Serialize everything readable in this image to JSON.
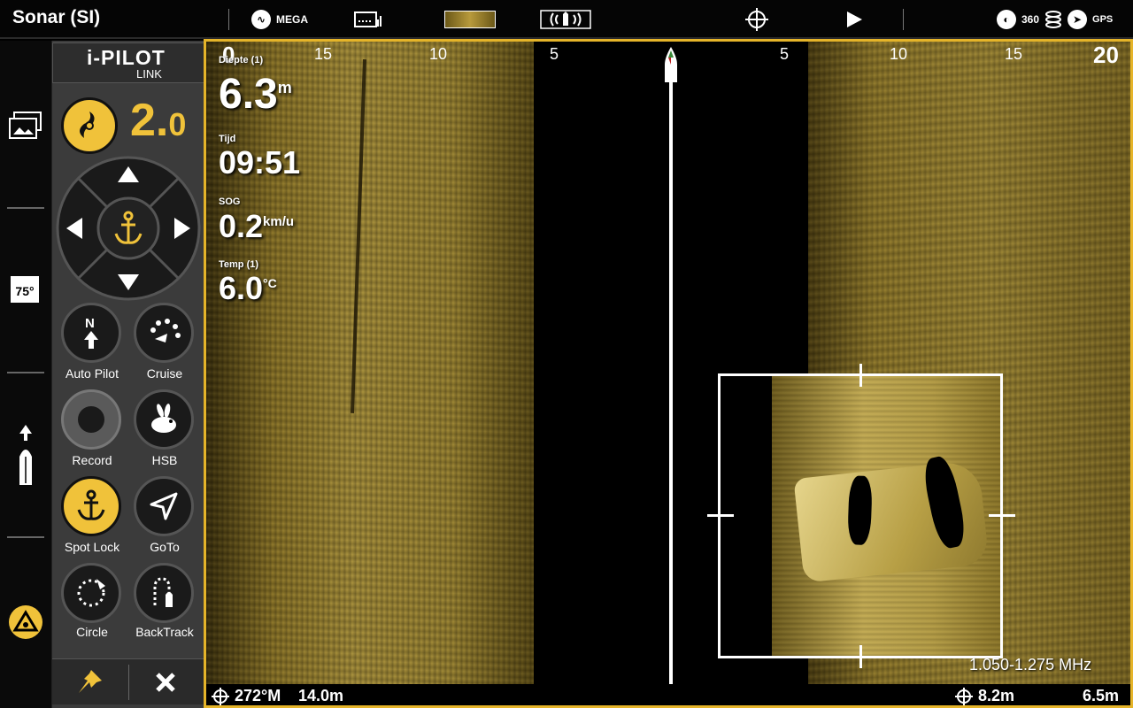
{
  "topbar": {
    "title": "Sonar (SI)",
    "mega_label": "MEGA",
    "right_360": "360",
    "gps_label": "GPS"
  },
  "leftcol": {
    "temp_icon_text": "75°"
  },
  "ipilot": {
    "brand": "i-PILOT",
    "sub": "LINK",
    "speed_main": "2.",
    "speed_decimal": "0",
    "buttons": [
      {
        "label": "Auto Pilot"
      },
      {
        "label": "Cruise"
      },
      {
        "label": "Record"
      },
      {
        "label": "HSB"
      },
      {
        "label": "Spot Lock"
      },
      {
        "label": "GoTo"
      },
      {
        "label": "Circle"
      },
      {
        "label": "BackTrack"
      }
    ]
  },
  "sonar": {
    "scale_left": [
      "0",
      "15",
      "10",
      "5"
    ],
    "scale_right": [
      "5",
      "10",
      "15",
      "20"
    ],
    "readouts": {
      "depth_label": "Diepte (1)",
      "depth_value": "6.3",
      "depth_unit": "m",
      "time_label": "Tijd",
      "time_value": "09:51",
      "sog_label": "SOG",
      "sog_value": "0.2",
      "sog_unit": "km/u",
      "temp_label": "Temp (1)",
      "temp_value": "6.0",
      "temp_unit": "°C"
    },
    "frequency": "1.050-1.275 MHz",
    "bottom": {
      "heading": "272°M",
      "distance": "14.0m",
      "cursor_distance": "8.2m",
      "range": "6.5m"
    }
  },
  "colors": {
    "accent": "#f0c23a",
    "frame": "#e5b429"
  }
}
